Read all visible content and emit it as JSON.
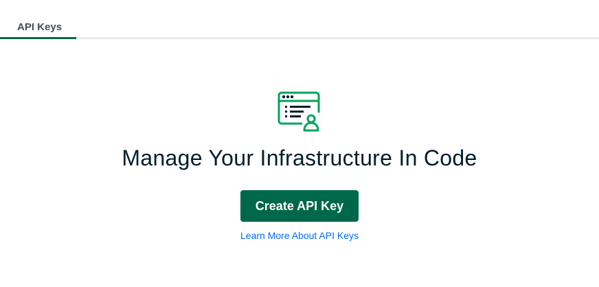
{
  "top_partial_text": "",
  "tabs": [
    {
      "label": "API Keys",
      "active": true
    }
  ],
  "empty_state": {
    "illustration_icon": "browser-user-list-icon",
    "heading": "Manage Your Infrastructure In Code",
    "cta_label": "Create API Key",
    "link_label": "Learn More About API Keys"
  },
  "colors": {
    "brand_green": "#00684a",
    "illustration_green": "#00ed64",
    "text_dark": "#001e2b",
    "link_blue": "#016bf8"
  }
}
